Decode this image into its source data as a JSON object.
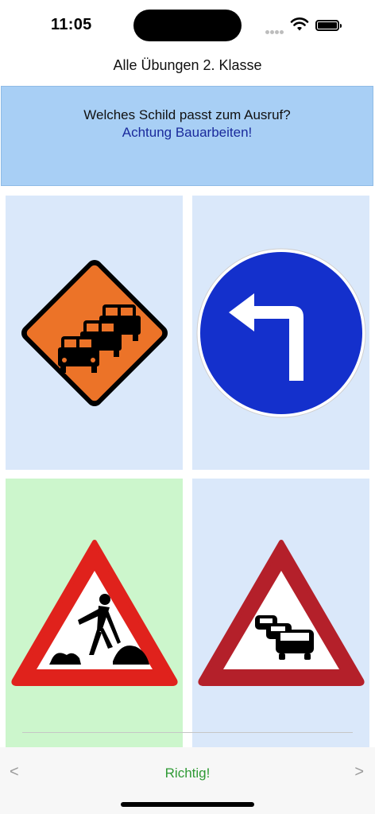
{
  "status_bar": {
    "time": "11:05"
  },
  "nav": {
    "title": "Alle Übungen 2. Klasse",
    "back_icon": "chevron-left-icon",
    "share_icon": "share-icon"
  },
  "question": {
    "prompt": "Welches Schild passt zum Ausruf?",
    "exclamation": "Achtung Bauarbeiten!"
  },
  "answers": [
    {
      "id": "stau-orange-diamond",
      "selected": false
    },
    {
      "id": "left-turn-round-blue",
      "selected": false
    },
    {
      "id": "roadworks-triangle",
      "selected": true
    },
    {
      "id": "traffic-jam-triangle",
      "selected": false
    }
  ],
  "toolbar": {
    "prev_label": "<",
    "result_label": "Richtig!",
    "next_label": ">"
  },
  "colors": {
    "question_bg": "#a8cff5",
    "tile_bg": "#dae8fa",
    "correct_bg": "#ccf6cc",
    "result_text": "#2f9a35",
    "exclamation_text": "#1a2a9c"
  }
}
